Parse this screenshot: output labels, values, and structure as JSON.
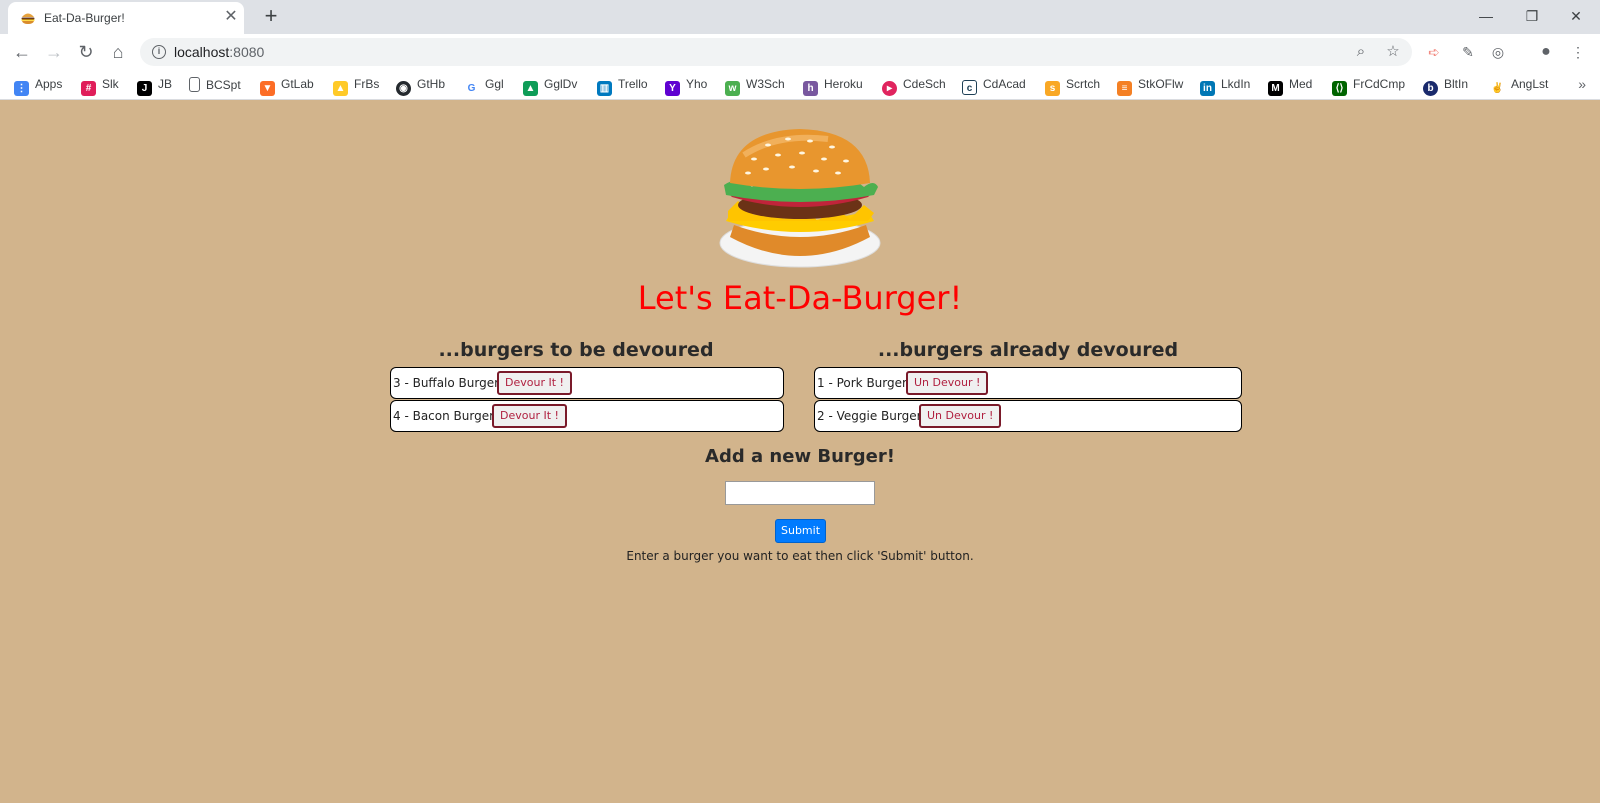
{
  "browser": {
    "tab_title": "Eat-Da-Burger!",
    "tab_close": "✕",
    "new_tab": "+",
    "url_host": "localhost",
    "url_port": ":8080",
    "window_minimize": "—",
    "window_restore": "❐",
    "window_close": "✕"
  },
  "bookmarks": [
    {
      "label": "Apps",
      "icon": "apps-grid-icon",
      "color": "#4285f4"
    },
    {
      "label": "Slk",
      "icon": "slack-icon",
      "color": "#e01e5a"
    },
    {
      "label": "JB",
      "icon": "jb-icon",
      "color": "#000000"
    },
    {
      "label": "BCSpt",
      "icon": "page-icon",
      "color": "#ffffff"
    },
    {
      "label": "GtLab",
      "icon": "gitlab-icon",
      "color": "#fc6d26"
    },
    {
      "label": "FrBs",
      "icon": "firebase-icon",
      "color": "#ffca28"
    },
    {
      "label": "GtHb",
      "icon": "github-icon",
      "color": "#24292e"
    },
    {
      "label": "Ggl",
      "icon": "google-icon",
      "color": "#4285f4"
    },
    {
      "label": "GglDv",
      "icon": "google-drive-icon",
      "color": "#0f9d58"
    },
    {
      "label": "Trello",
      "icon": "trello-icon",
      "color": "#0079bf"
    },
    {
      "label": "Yho",
      "icon": "yahoo-icon",
      "color": "#5f01d1"
    },
    {
      "label": "W3Sch",
      "icon": "w3schools-icon",
      "color": "#4caf50"
    },
    {
      "label": "Heroku",
      "icon": "heroku-icon",
      "color": "#79589f"
    },
    {
      "label": "CdeSch",
      "icon": "codeschool-icon",
      "color": "#e0245e"
    },
    {
      "label": "CdAcad",
      "icon": "codecademy-icon",
      "color": "#1f4056"
    },
    {
      "label": "Scrtch",
      "icon": "scratch-icon",
      "color": "#f9a825"
    },
    {
      "label": "StkOFlw",
      "icon": "stackoverflow-icon",
      "color": "#f48024"
    },
    {
      "label": "LkdIn",
      "icon": "linkedin-icon",
      "color": "#0077b5"
    },
    {
      "label": "Med",
      "icon": "medium-icon",
      "color": "#000000"
    },
    {
      "label": "FrCdCmp",
      "icon": "freecodecamp-icon",
      "color": "#006400"
    },
    {
      "label": "BltIn",
      "icon": "builtin-icon",
      "color": "#1a2a6c"
    },
    {
      "label": "AngLst",
      "icon": "angellist-icon",
      "color": "#000000"
    }
  ],
  "page": {
    "heading": "Let's Eat-Da-Burger!",
    "heading_color": "#ff0000",
    "background_color": "#d2b48c",
    "to_devour": {
      "title": "...burgers to be devoured",
      "items": [
        {
          "name": "3 - Buffalo Burger",
          "button": "Devour It !"
        },
        {
          "name": "4 - Bacon Burger",
          "button": "Devour It !"
        }
      ]
    },
    "devoured": {
      "title": "...burgers already devoured",
      "items": [
        {
          "name": "1 - Pork Burger",
          "button": "Un Devour !"
        },
        {
          "name": "2 - Veggie Burger",
          "button": "Un Devour !"
        }
      ]
    },
    "add_form": {
      "title": "Add a new Burger!",
      "input_value": "",
      "submit_label": "Submit",
      "submit_color": "#007bff",
      "hint": "Enter a burger you want to eat then click 'Submit' button."
    }
  }
}
